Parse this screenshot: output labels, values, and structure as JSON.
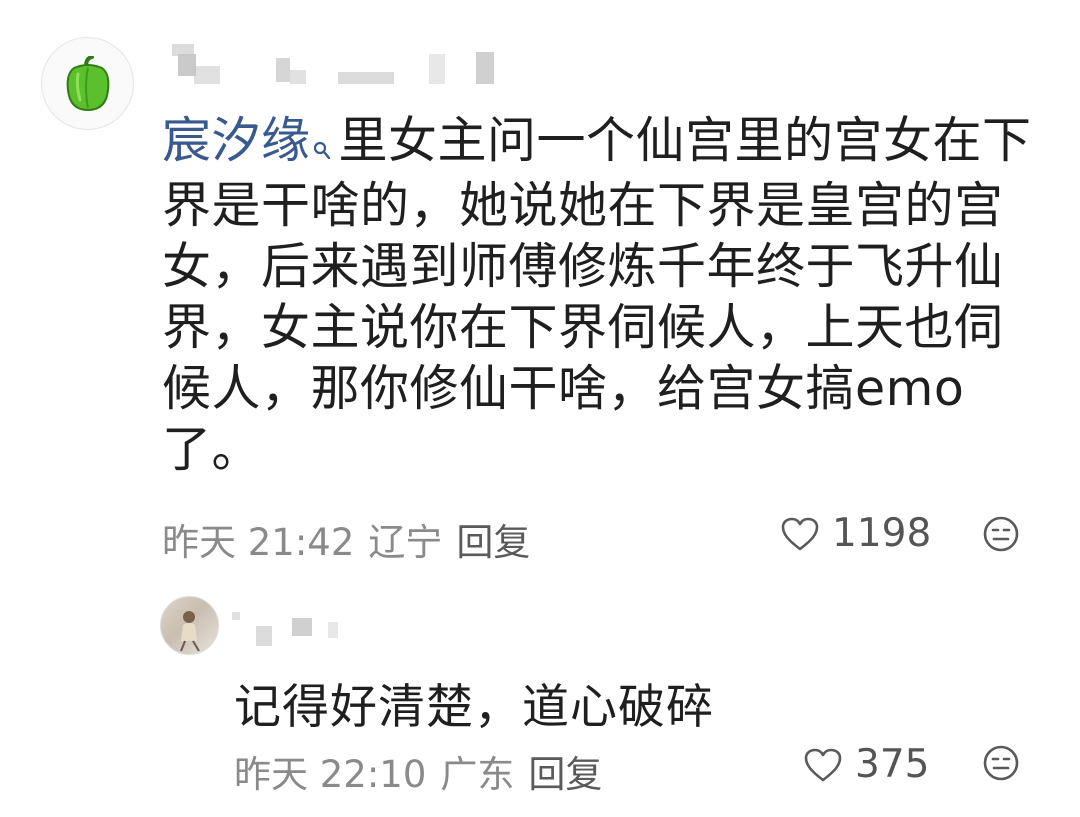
{
  "comment": {
    "link_text": "宸汐缘",
    "body": "里女主问一个仙宫里的宫女在下界是干啥的，她说她在下界是皇宫的宫女，后来遇到师傅修炼千年终于飞升仙界，女主说你在下界伺候人，上天也伺候人，那你修仙干啥，给宫女搞emo了。",
    "time": "昨天 21:42",
    "location": "辽宁",
    "reply_label": "回复",
    "likes": "1198"
  },
  "reply": {
    "text": "记得好清楚，道心破碎",
    "time": "昨天 22:10",
    "location": "广东",
    "reply_label": "回复",
    "likes": "375"
  },
  "icons": {
    "main_avatar": "green-pepper-icon",
    "link_suffix": "search-icon",
    "like": "heart-outline-icon",
    "emoji": "neutral-face-icon"
  },
  "colors": {
    "link": "#395a8e",
    "text": "#1f1f1f",
    "meta": "#8a8a8a",
    "pepper": "#5cc02c"
  }
}
